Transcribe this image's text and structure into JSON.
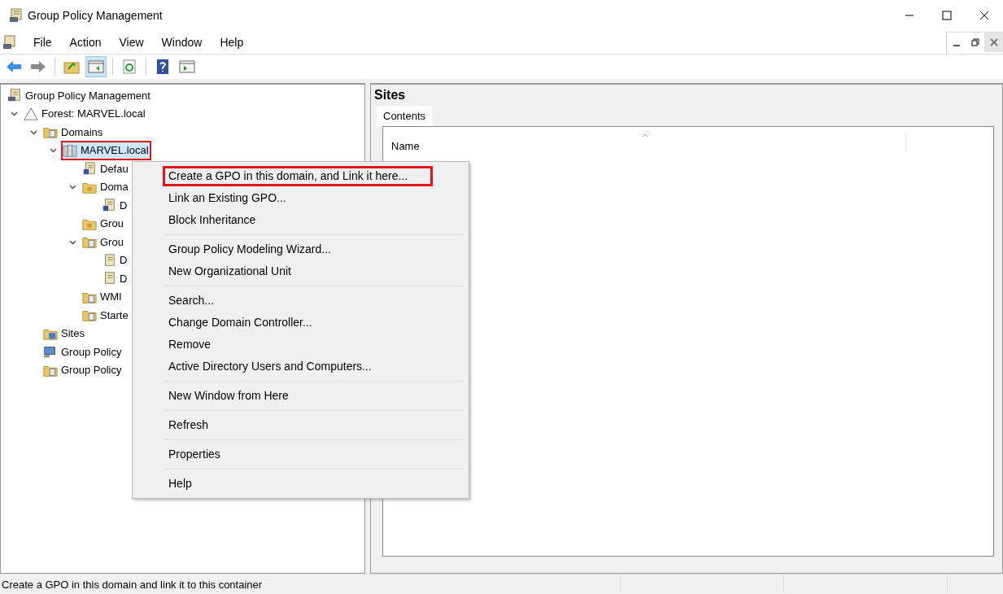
{
  "window": {
    "title": "Group Policy Management"
  },
  "menu_bar": [
    "File",
    "Action",
    "View",
    "Window",
    "Help"
  ],
  "toolbar": [
    {
      "kind": "back",
      "pressed": false
    },
    {
      "kind": "forward",
      "pressed": false
    },
    {
      "kind": "sep"
    },
    {
      "kind": "up",
      "pressed": false
    },
    {
      "kind": "tree",
      "pressed": true
    },
    {
      "kind": "sep"
    },
    {
      "kind": "refresh",
      "pressed": false
    },
    {
      "kind": "sep"
    },
    {
      "kind": "help",
      "pressed": false
    },
    {
      "kind": "action-pane",
      "pressed": false
    }
  ],
  "tree": [
    {
      "label": "Group Policy Management",
      "kind": "console",
      "selected": false,
      "children": [
        {
          "label": "Forest: MARVEL.local",
          "kind": "forest",
          "expanded": true,
          "selected": false,
          "children": [
            {
              "label": "Domains",
              "kind": "domains",
              "expanded": true,
              "selected": false,
              "children": [
                {
                  "label": "MARVEL.local",
                  "kind": "domain",
                  "expanded": true,
                  "selected": true,
                  "highlighted": true,
                  "children": [
                    {
                      "label": "Defau",
                      "kind": "gpo-link",
                      "selected": false
                    },
                    {
                      "label": "Doma",
                      "kind": "ou",
                      "expanded": true,
                      "selected": false,
                      "children": [
                        {
                          "label": "D",
                          "kind": "gpo-link",
                          "selected": false
                        }
                      ]
                    },
                    {
                      "label": "Grou",
                      "kind": "ou",
                      "selected": false
                    },
                    {
                      "label": "Grou",
                      "kind": "gpo-folder",
                      "expanded": true,
                      "selected": false,
                      "children": [
                        {
                          "label": "D",
                          "kind": "gpo",
                          "selected": false
                        },
                        {
                          "label": "D",
                          "kind": "gpo",
                          "selected": false
                        }
                      ]
                    },
                    {
                      "label": "WMI",
                      "kind": "wmi",
                      "selected": false
                    },
                    {
                      "label": "Starte",
                      "kind": "starter",
                      "selected": false
                    }
                  ]
                }
              ]
            },
            {
              "label": "Sites",
              "kind": "sites",
              "selected": false
            },
            {
              "label": "Group Policy",
              "kind": "modeling",
              "selected": false
            },
            {
              "label": "Group Policy",
              "kind": "results",
              "selected": false
            }
          ]
        }
      ]
    }
  ],
  "right_pane": {
    "title": "Sites",
    "tabs": [
      {
        "label": "Contents",
        "selected": true
      }
    ],
    "columns": [
      "Name"
    ]
  },
  "context_menu": [
    [
      {
        "label": "Create a GPO in this domain, and Link it here...",
        "highlighted": true
      },
      {
        "label": "Link an Existing GPO...",
        "highlighted": false
      },
      {
        "label": "Block Inheritance",
        "highlighted": false
      }
    ],
    [
      {
        "label": "Group Policy Modeling Wizard...",
        "highlighted": false
      },
      {
        "label": "New Organizational Unit",
        "highlighted": false
      }
    ],
    [
      {
        "label": "Search...",
        "highlighted": false
      },
      {
        "label": "Change Domain Controller...",
        "highlighted": false
      },
      {
        "label": "Remove",
        "highlighted": false
      },
      {
        "label": "Active Directory Users and Computers...",
        "highlighted": false
      }
    ],
    [
      {
        "label": "New Window from Here",
        "highlighted": false
      }
    ],
    [
      {
        "label": "Refresh",
        "highlighted": false
      }
    ],
    [
      {
        "label": "Properties",
        "highlighted": false
      }
    ],
    [
      {
        "label": "Help",
        "highlighted": false
      }
    ]
  ],
  "status_bar": "Create a GPO in this domain and link it to this container"
}
